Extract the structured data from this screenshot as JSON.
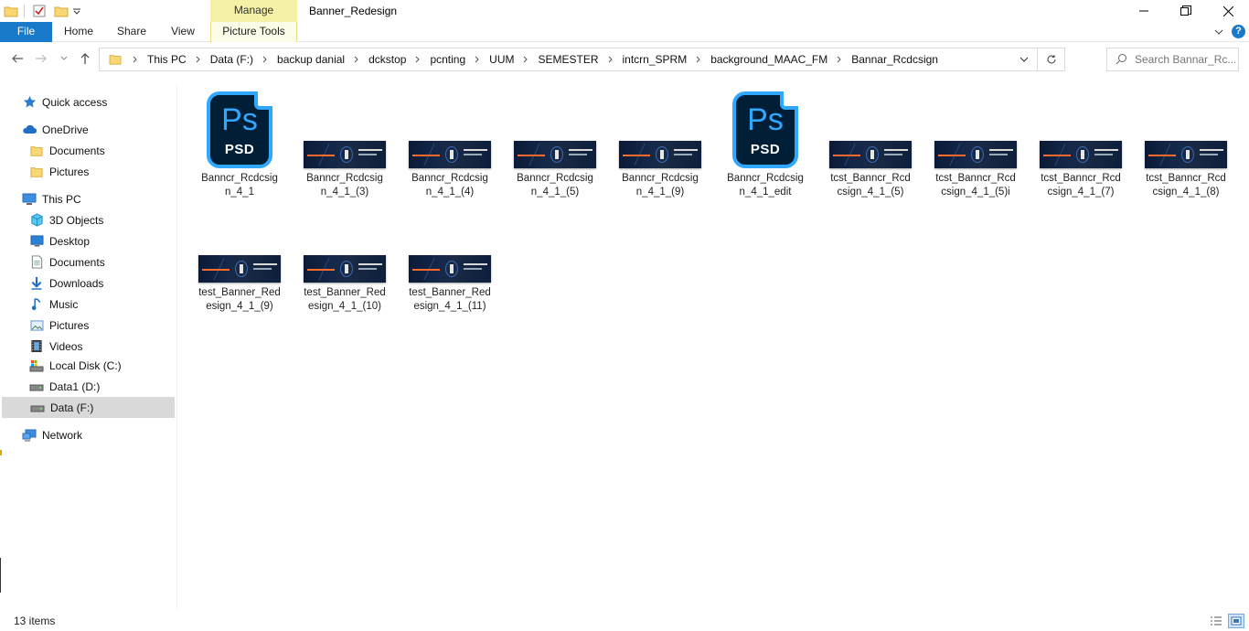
{
  "window": {
    "title": "Banner_Redesign",
    "contextual_group": "Manage"
  },
  "ribbon": {
    "tabs": [
      "File",
      "Home",
      "Share",
      "View"
    ],
    "contextual_tab": "Picture Tools"
  },
  "address": {
    "crumbs": [
      "This PC",
      "Data (F:)",
      "backup danial",
      "dckstop",
      "pcnting",
      "UUM",
      "SEMESTER",
      "intcrn_SPRM",
      "background_MAAC_FM",
      "Bannar_Rcdcsign"
    ]
  },
  "search": {
    "placeholder": "Search Bannar_Rc..."
  },
  "sidebar": {
    "items": [
      {
        "label": "Quick access",
        "icon": "star-icon"
      },
      {
        "label": "OneDrive",
        "icon": "cloud-icon"
      },
      {
        "label": "Documents",
        "icon": "folder-icon"
      },
      {
        "label": "Pictures",
        "icon": "folder-icon"
      },
      {
        "label": "This PC",
        "icon": "computer-icon"
      },
      {
        "label": "3D Objects",
        "icon": "cube-icon"
      },
      {
        "label": "Desktop",
        "icon": "desktop-icon"
      },
      {
        "label": "Documents",
        "icon": "documents-icon"
      },
      {
        "label": "Downloads",
        "icon": "download-icon"
      },
      {
        "label": "Music",
        "icon": "music-icon"
      },
      {
        "label": "Pictures",
        "icon": "pictures-icon"
      },
      {
        "label": "Videos",
        "icon": "film-icon"
      },
      {
        "label": "Local Disk (C:)",
        "icon": "drive-c-icon"
      },
      {
        "label": "Data1 (D:)",
        "icon": "drive-icon"
      },
      {
        "label": "Data (F:)",
        "icon": "drive-icon",
        "selected": true
      },
      {
        "label": "Network",
        "icon": "network-icon"
      }
    ]
  },
  "files": [
    {
      "name": "Banncr_Rcdcsign_4_1",
      "type": "psd"
    },
    {
      "name": "Banncr_Rcdcsign_4_1_(3)",
      "type": "image"
    },
    {
      "name": "Banncr_Rcdcsign_4_1_(4)",
      "type": "image"
    },
    {
      "name": "Banncr_Rcdcsign_4_1_(5)",
      "type": "image"
    },
    {
      "name": "Banncr_Rcdcsign_4_1_(9)",
      "type": "image"
    },
    {
      "name": "Banncr_Rcdcsign_4_1_edit",
      "type": "psd"
    },
    {
      "name": "tcst_Banncr_Rcdcsign_4_1_(5)",
      "type": "image"
    },
    {
      "name": "tcst_Banncr_Rcdcsign_4_1_(5)i",
      "type": "image"
    },
    {
      "name": "tcst_Banncr_Rcdcsign_4_1_(7)",
      "type": "image"
    },
    {
      "name": "tcst_Banncr_Rcdcsign_4_1_(8)",
      "type": "image"
    },
    {
      "name": "test_Banner_Redesign_4_1_(9)",
      "type": "image"
    },
    {
      "name": "test_Banner_Redesign_4_1_(10)",
      "type": "image"
    },
    {
      "name": "test_Banner_Redesign_4_1_(11)",
      "type": "image"
    }
  ],
  "psd_icon": {
    "mark": "Ps",
    "caption": "PSD"
  },
  "status": {
    "item_count": "13 items"
  },
  "colors": {
    "accent": "#1979ca",
    "manage_tab": "#f5f1a6",
    "selection": "#d9d9d9",
    "ps_blue": "#31a8ff",
    "ps_bg": "#001e36"
  }
}
